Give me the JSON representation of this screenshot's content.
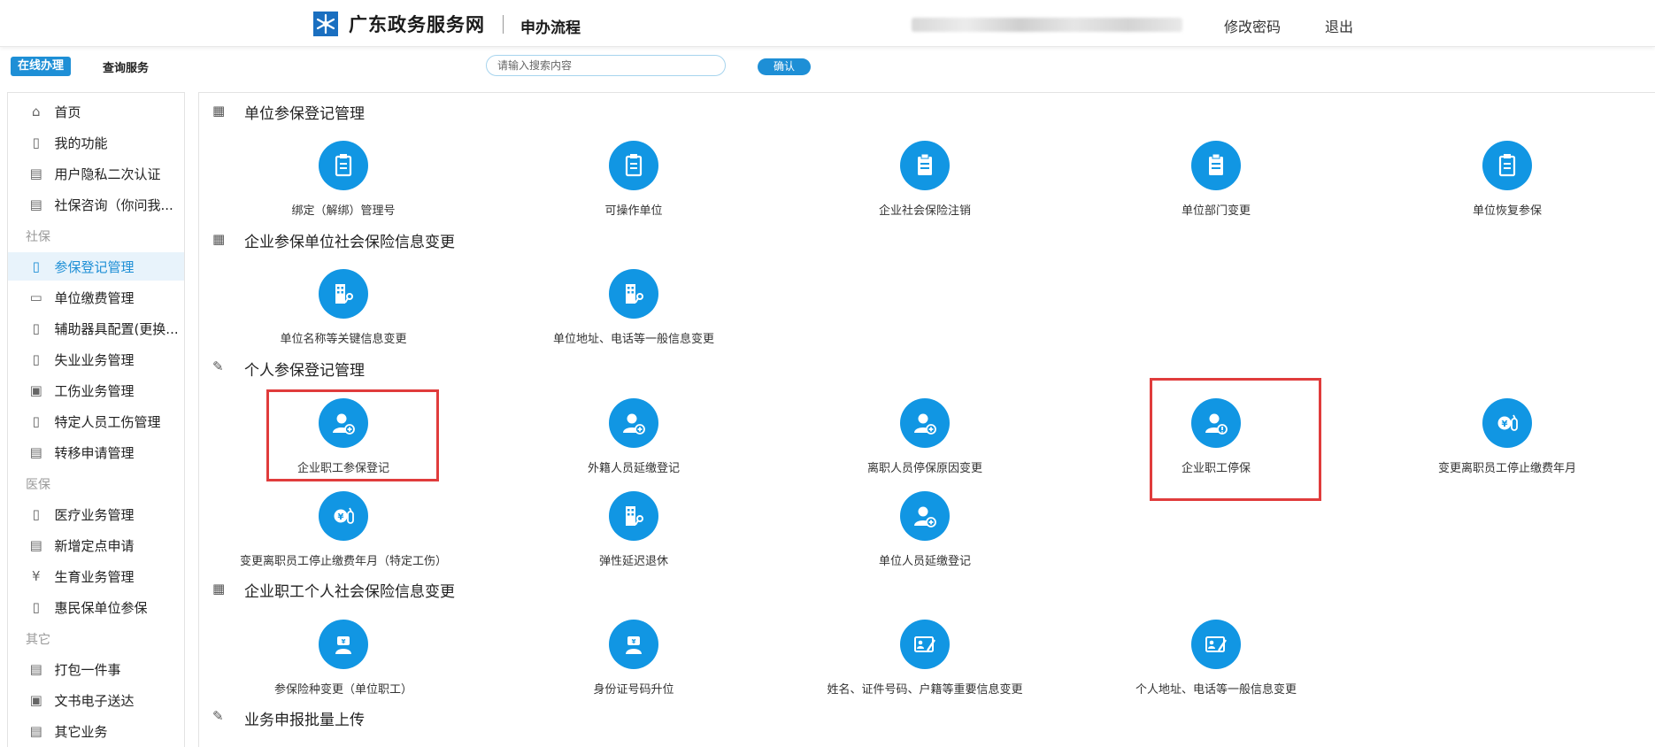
{
  "header": {
    "site_title": "广东政务服务网",
    "flow_title": "申办流程",
    "change_password": "修改密码",
    "logout": "退出"
  },
  "topbar": {
    "online_tab": "在线办理",
    "query_tab": "查询服务",
    "search_placeholder": "请输入搜索内容",
    "confirm": "确认"
  },
  "sidebar": {
    "items": [
      {
        "label": "首页",
        "icon": "home-icon"
      },
      {
        "label": "我的功能",
        "icon": "clipboard-icon"
      },
      {
        "label": "用户隐私二次认证",
        "icon": "building-icon"
      },
      {
        "label": "社保咨询（你问我...",
        "icon": "building-icon"
      }
    ],
    "group_social": "社保",
    "social_items": [
      {
        "label": "参保登记管理",
        "icon": "clipboard-icon",
        "active": true
      },
      {
        "label": "单位缴费管理",
        "icon": "form-icon"
      },
      {
        "label": "辅助器具配置(更换...",
        "icon": "clipboard-icon"
      },
      {
        "label": "失业业务管理",
        "icon": "clipboard-icon"
      },
      {
        "label": "工伤业务管理",
        "icon": "id-card-icon"
      },
      {
        "label": "特定人员工伤管理",
        "icon": "clipboard-icon"
      },
      {
        "label": "转移申请管理",
        "icon": "building-icon"
      }
    ],
    "group_medical": "医保",
    "medical_items": [
      {
        "label": "医疗业务管理",
        "icon": "clipboard-icon"
      },
      {
        "label": "新增定点申请",
        "icon": "building-icon"
      },
      {
        "label": "生育业务管理",
        "icon": "yen-doc-icon"
      },
      {
        "label": "惠民保单位参保",
        "icon": "clipboard-icon"
      }
    ],
    "group_other": "其它",
    "other_items": [
      {
        "label": "打包一件事",
        "icon": "building-icon"
      },
      {
        "label": "文书电子送达",
        "icon": "id-card-icon"
      },
      {
        "label": "其它业务",
        "icon": "building-icon"
      }
    ]
  },
  "sections": [
    {
      "title": "单位参保登记管理",
      "tiles": [
        "绑定（解绑）管理号",
        "可操作单位",
        "企业社会保险注销",
        "单位部门变更",
        "单位恢复参保"
      ]
    },
    {
      "title": "企业参保单位社会保险信息变更",
      "tiles": [
        "单位名称等关键信息变更",
        "单位地址、电话等一般信息变更"
      ]
    },
    {
      "title": "个人参保登记管理",
      "tiles": [
        "企业职工参保登记",
        "外籍人员延缴登记",
        "离职人员停保原因变更",
        "企业职工停保",
        "变更离职员工停止缴费年月",
        "变更离职员工停止缴费年月（特定工伤）",
        "弹性延迟退休",
        "单位人员延缴登记"
      ]
    },
    {
      "title": "企业职工个人社会保险信息变更",
      "tiles": [
        "参保险种变更（单位职工）",
        "身份证号码升位",
        "姓名、证件号码、户籍等重要信息变更",
        "个人地址、电话等一般信息变更"
      ]
    },
    {
      "title": "业务申报批量上传",
      "tiles": []
    }
  ],
  "colors": {
    "accent": "#1e8fd6",
    "tile_circle": "#1196e3",
    "highlight": "#e03c3c"
  }
}
